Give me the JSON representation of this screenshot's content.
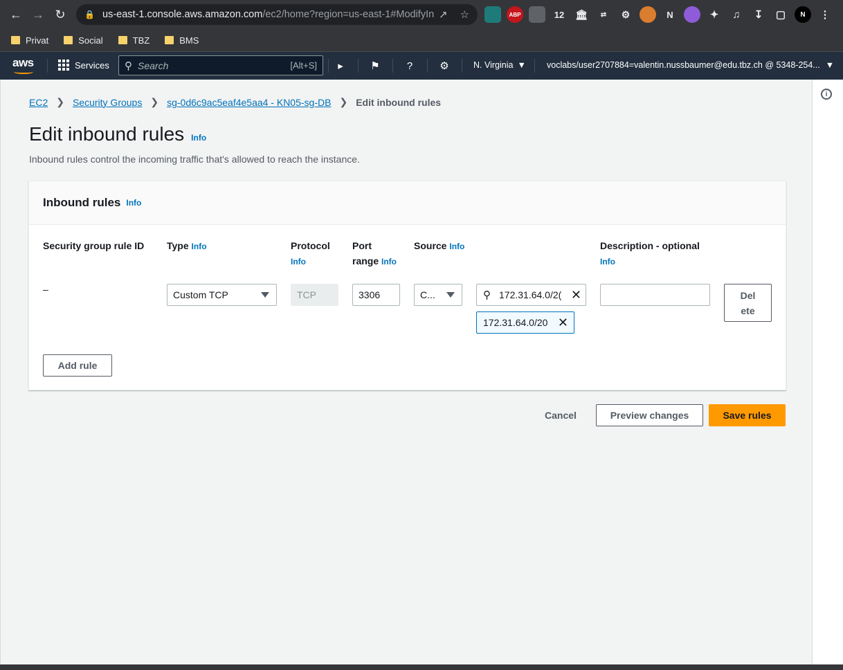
{
  "browser": {
    "url_host": "us-east-1.console.aws.amazon.com",
    "url_rest": "/ec2/home?region=us-east-1#ModifyIn...",
    "bookmarks": [
      "Privat",
      "Social",
      "TBZ",
      "BMS"
    ],
    "ext_abp": "ABP",
    "ext_twelve": "12",
    "ext_n": "N"
  },
  "awsnav": {
    "logo": "aws",
    "services": "Services",
    "search_placeholder": "Search",
    "search_shortcut": "[Alt+S]",
    "region": "N. Virginia",
    "account": "voclabs/user2707884=valentin.nussbaumer@edu.tbz.ch @ 5348-254..."
  },
  "breadcrumb": {
    "items": [
      "EC2",
      "Security Groups",
      "sg-0d6c9ac5eaf4e5aa4 - KN05-sg-DB"
    ],
    "current": "Edit inbound rules"
  },
  "page": {
    "title": "Edit inbound rules",
    "info": "Info",
    "subtitle": "Inbound rules control the incoming traffic that's allowed to reach the instance."
  },
  "panel": {
    "title": "Inbound rules",
    "info": "Info",
    "columns": {
      "rule_id": "Security group rule ID",
      "type": "Type",
      "protocol": "Protocol",
      "port_line1": "Port",
      "port_line2": "range",
      "source": "Source",
      "description": "Description - optional",
      "info": "Info"
    },
    "row": {
      "rule_id": "–",
      "type": "Custom TCP",
      "protocol": "TCP",
      "port": "3306",
      "source_type": "C...",
      "source_value": "172.31.64.0/2(",
      "source_token": "172.31.64.0/20",
      "description": "",
      "delete_line1": "Del",
      "delete_line2": "ete"
    },
    "add_rule": "Add rule"
  },
  "footer": {
    "cancel": "Cancel",
    "preview": "Preview changes",
    "save": "Save rules"
  },
  "colors": {
    "aws_nav": "#232f3e",
    "link": "#0073bb",
    "primary": "#ec7211"
  }
}
